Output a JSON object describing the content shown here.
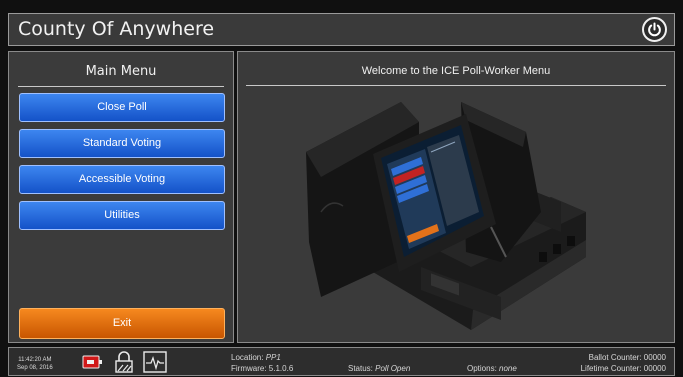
{
  "header": {
    "title": "County Of Anywhere"
  },
  "menu": {
    "title": "Main Menu",
    "items": [
      {
        "label": "Close Poll"
      },
      {
        "label": "Standard Voting"
      },
      {
        "label": "Accessible Voting"
      },
      {
        "label": "Utilities"
      }
    ],
    "exit_label": "Exit"
  },
  "main": {
    "welcome": "Welcome to the ICE Poll-Worker Menu"
  },
  "status_bar": {
    "time": "11:42:20 AM",
    "date": "Sep 08, 2016",
    "location_label": "Location:",
    "location_value": "PP1",
    "firmware_label": "Firmware:",
    "firmware_value": "5.1.0.6",
    "status_label": "Status:",
    "status_value": "Poll Open",
    "options_label": "Options:",
    "options_value": "none",
    "ballot_counter": "Ballot Counter: 00000",
    "lifetime_counter": "Lifetime Counter: 00000"
  },
  "colors": {
    "menu_button": "#1f64dc",
    "exit_button": "#e56f0d",
    "background": "#101010",
    "panel": "#3a3a3a"
  },
  "icons": [
    "power-icon",
    "battery-plug-icon",
    "lock-icon",
    "heartbeat-icon"
  ]
}
